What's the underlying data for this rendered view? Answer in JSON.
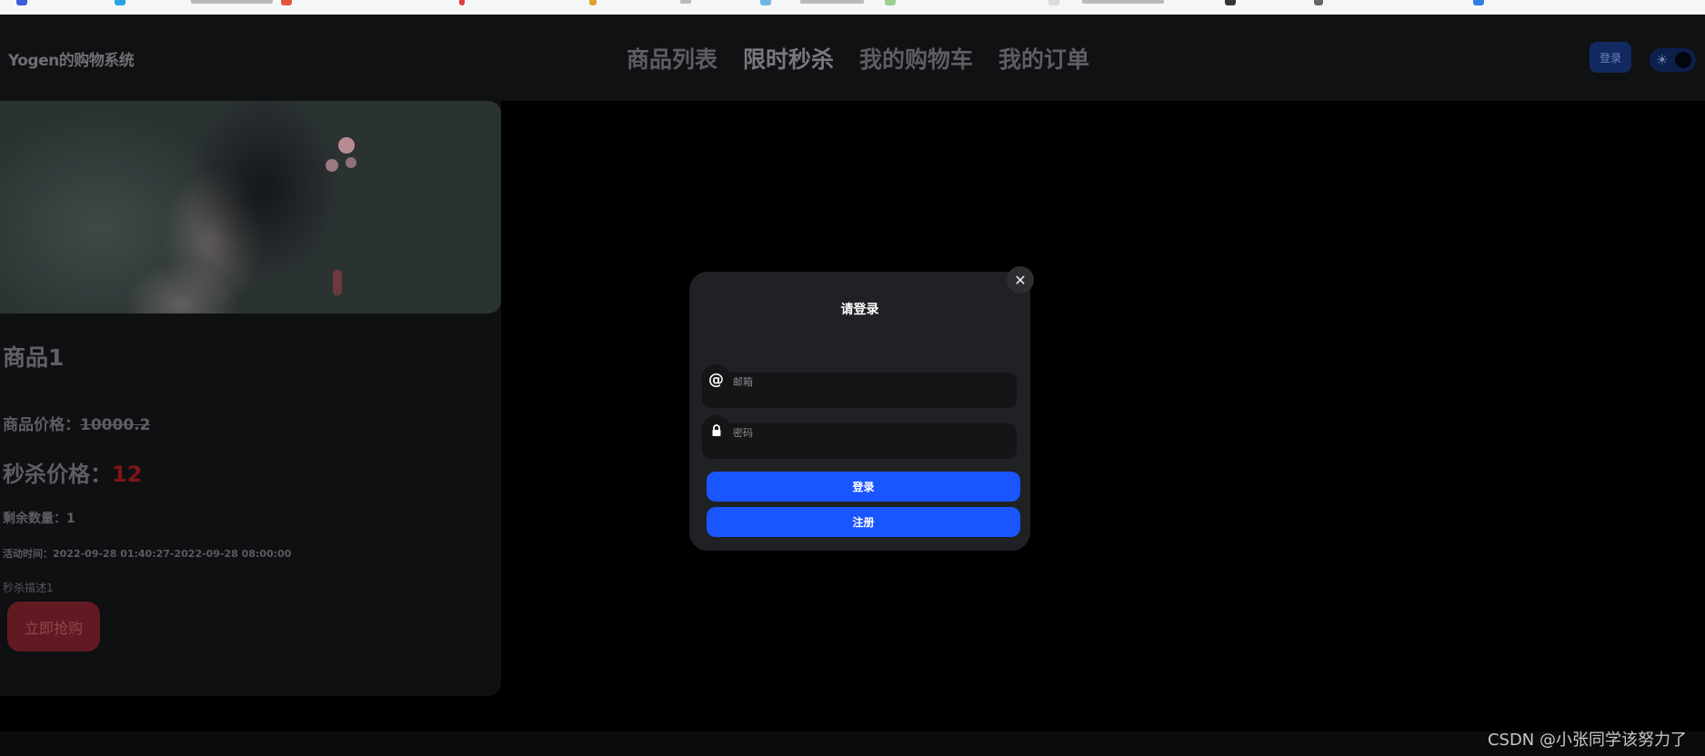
{
  "header": {
    "brand": "Yogen的购物系统",
    "nav": [
      "商品列表",
      "限时秒杀",
      "我的购物车",
      "我的订单"
    ],
    "login_label": "登录",
    "theme_icon": "sun-icon"
  },
  "product": {
    "title": "商品1",
    "price_label": "商品价格：",
    "price_value": "10000.2",
    "flash_label": "秒杀价格：",
    "flash_value": "12",
    "stock_text": "剩余数量：1",
    "time_text": "活动时间：2022-09-28 01:40:27-2022-09-28 08:00:00",
    "description": "秒杀描述1",
    "buy_label": "立即抢购"
  },
  "modal": {
    "title": "请登录",
    "email_placeholder": "邮箱",
    "password_placeholder": "密码",
    "email_icon": "@",
    "submit_label": "登录",
    "register_label": "注册",
    "close_icon": "✕"
  },
  "watermark": "CSDN @小张同学该努力了",
  "colors": {
    "accent": "#1a56ff",
    "flash_price": "#7e1515",
    "background": "#000000"
  }
}
